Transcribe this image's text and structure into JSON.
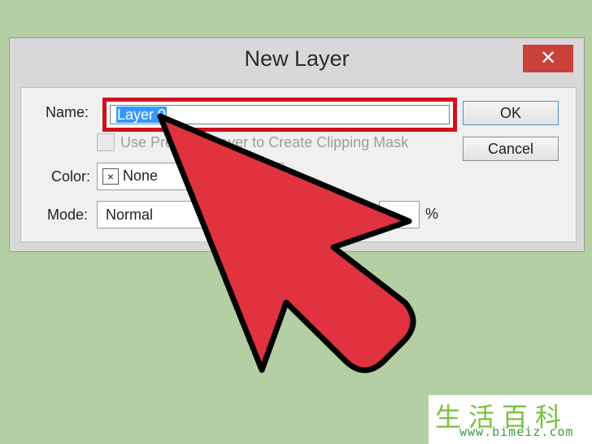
{
  "dialog": {
    "title": "New Layer",
    "close_glyph": "✕",
    "name_label": "Name:",
    "name_value": "Layer 0",
    "clip_label": "Use Previous Layer to Create Clipping Mask",
    "color_label": "Color:",
    "color_icon": "×",
    "color_value": "None",
    "mode_label": "Mode:",
    "mode_value": "Normal",
    "percent": "%",
    "ok_label": "OK",
    "cancel_label": "Cancel"
  },
  "annotation": {
    "arrow_color": "#e0323f",
    "highlight_color": "#d0101c"
  },
  "watermark": {
    "chinese": "生活百科",
    "url": "www.bimeiz.com"
  }
}
